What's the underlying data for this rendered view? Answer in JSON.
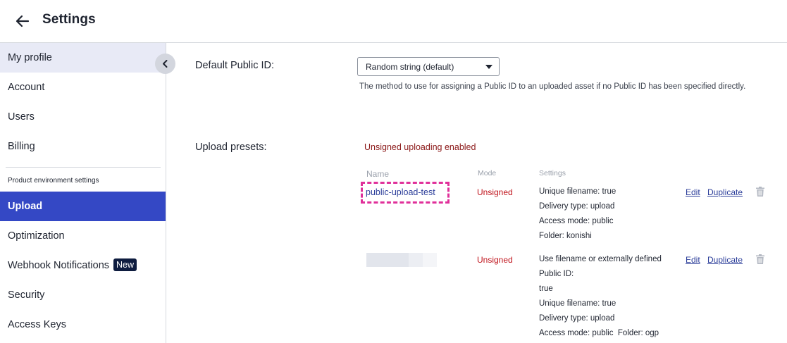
{
  "header": {
    "title": "Settings"
  },
  "sidebar": {
    "items": [
      {
        "label": "My profile"
      },
      {
        "label": "Account"
      },
      {
        "label": "Users"
      },
      {
        "label": "Billing"
      }
    ],
    "section_label": "Product environment settings",
    "env_items": [
      {
        "label": "Upload"
      },
      {
        "label": "Optimization"
      },
      {
        "label": "Webhook Notifications",
        "badge": "New"
      },
      {
        "label": "Security"
      },
      {
        "label": "Access Keys"
      }
    ],
    "active_item": "Upload"
  },
  "main": {
    "public_id_label": "Default Public ID:",
    "public_id_select": {
      "value": "Random string (default)"
    },
    "public_id_help": "The method to use for assigning a Public ID to an uploaded asset if no Public ID has been specified directly.",
    "upload_presets_label": "Upload presets:",
    "unsigned_status": "Unsigned uploading enabled",
    "columns": {
      "name": "Name",
      "mode": "Mode",
      "settings": "Settings"
    },
    "presets": [
      {
        "name": "public-upload-test",
        "mode": "Unsigned",
        "settings": [
          "Unique filename: true",
          "Delivery type: upload",
          "Access mode: public",
          "Folder: konishi"
        ],
        "edit_label": "Edit",
        "duplicate_label": "Duplicate"
      },
      {
        "name": "",
        "mode": "Unsigned",
        "settings": [
          "Use filename or externally defined",
          "Public ID:",
          "true",
          "Unique filename: true",
          "Delivery type: upload",
          "Access mode: public  Folder: ogp"
        ],
        "edit_label": "Edit",
        "duplicate_label": "Duplicate"
      }
    ]
  },
  "colors": {
    "accent": "#3448c5",
    "highlight_border": "#e0309a",
    "unsigned_red": "#c0141c",
    "link": "#2c3e9a"
  }
}
